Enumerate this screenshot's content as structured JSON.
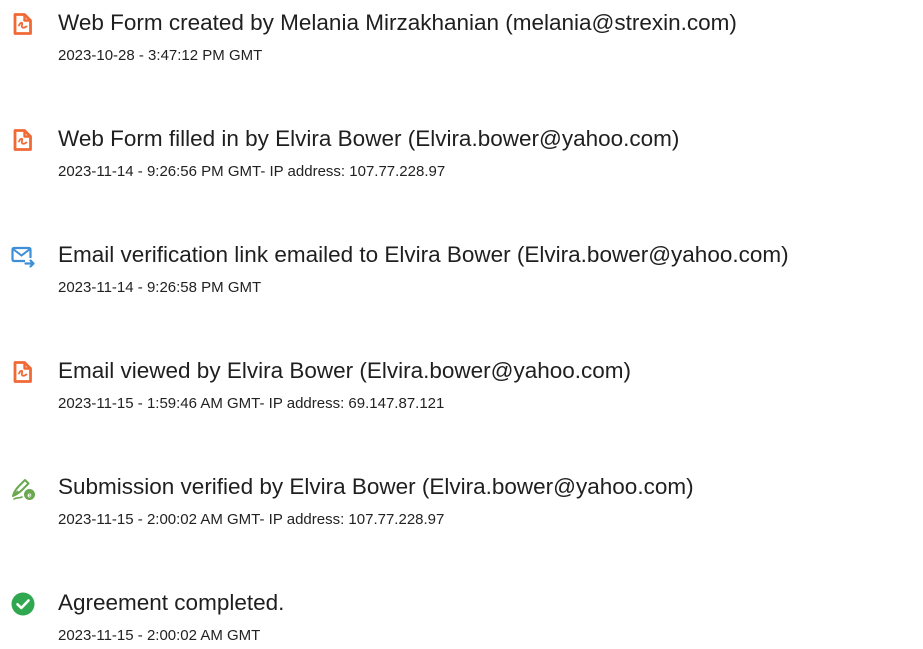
{
  "colors": {
    "document_icon": "#f06a35",
    "email_icon": "#3d8fd6",
    "verify_icon": "#6aa84f",
    "complete_icon": "#2fa84f",
    "text": "#1f1f1f"
  },
  "entries": [
    {
      "icon": "document-icon",
      "title": "Web Form created by Melania Mirzakhanian (melania@strexin.com)",
      "meta": "2023-10-28 - 3:47:12 PM GMT"
    },
    {
      "icon": "document-icon",
      "title": "Web Form filled in by Elvira Bower (Elvira.bower@yahoo.com)",
      "meta": "2023-11-14 - 9:26:56 PM GMT- IP address: 107.77.228.97"
    },
    {
      "icon": "email-send-icon",
      "title": "Email verification link emailed to Elvira Bower (Elvira.bower@yahoo.com)",
      "meta": "2023-11-14 - 9:26:58 PM GMT"
    },
    {
      "icon": "document-icon",
      "title": "Email viewed by Elvira Bower (Elvira.bower@yahoo.com)",
      "meta": "2023-11-15 - 1:59:46 AM GMT- IP address: 69.147.87.121"
    },
    {
      "icon": "pen-verify-icon",
      "title": "Submission verified by Elvira Bower (Elvira.bower@yahoo.com)",
      "meta": "2023-11-15 - 2:00:02 AM GMT- IP address: 107.77.228.97"
    },
    {
      "icon": "check-circle-icon",
      "title": "Agreement completed.",
      "meta": "2023-11-15 - 2:00:02 AM GMT"
    }
  ]
}
